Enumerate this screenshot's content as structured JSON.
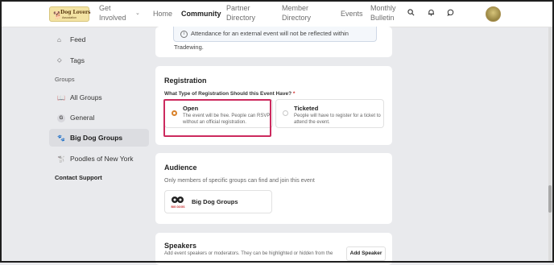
{
  "header": {
    "logo": {
      "title": "Dog Lovers",
      "subtitle": "Association"
    },
    "nav": [
      {
        "label": "Get\nInvolved",
        "line1": "Get",
        "line2": "Involved"
      },
      {
        "label": "Home"
      },
      {
        "label": "Community"
      },
      {
        "line1": "Partner",
        "line2": "Directory"
      },
      {
        "line1": "Member",
        "line2": "Directory"
      },
      {
        "label": "Events"
      },
      {
        "line1": "Monthly",
        "line2": "Bulletin"
      }
    ],
    "icons": [
      "search-icon",
      "bell-icon",
      "chat-icon"
    ]
  },
  "sidebar": {
    "feed": "Feed",
    "tags": "Tags",
    "groups_heading": "Groups",
    "all_groups": "All Groups",
    "general": "General",
    "general_badge": "G",
    "big_dog_groups": "Big Dog Groups",
    "poodles": "Poodles of New York",
    "contact_support": "Contact Support"
  },
  "notice": "Attendance for an external event will not be reflected within Tradewing.",
  "registration": {
    "title": "Registration",
    "question": "What Type of Registration Should this Event Have?",
    "required_mark": "*",
    "options": [
      {
        "title": "Open",
        "desc": "The event will be free. People can RSVP without an official registration.",
        "selected": true
      },
      {
        "title": "Ticketed",
        "desc": "People will have to register for a ticket to attend the event.",
        "selected": false
      }
    ]
  },
  "audience": {
    "title": "Audience",
    "subtitle": "Only members of specific groups can find and join this event",
    "group_name": "Big Dog Groups",
    "group_logo_text": "BIG DOGS"
  },
  "speakers": {
    "title": "Speakers",
    "subtitle": "Add event speakers or moderators. They can be highlighted or hidden from the",
    "add_label": "Add Speaker"
  },
  "colors": {
    "accent": "#d9822b",
    "highlight": "#cc2a5e",
    "page_bg": "#e9eaed"
  }
}
